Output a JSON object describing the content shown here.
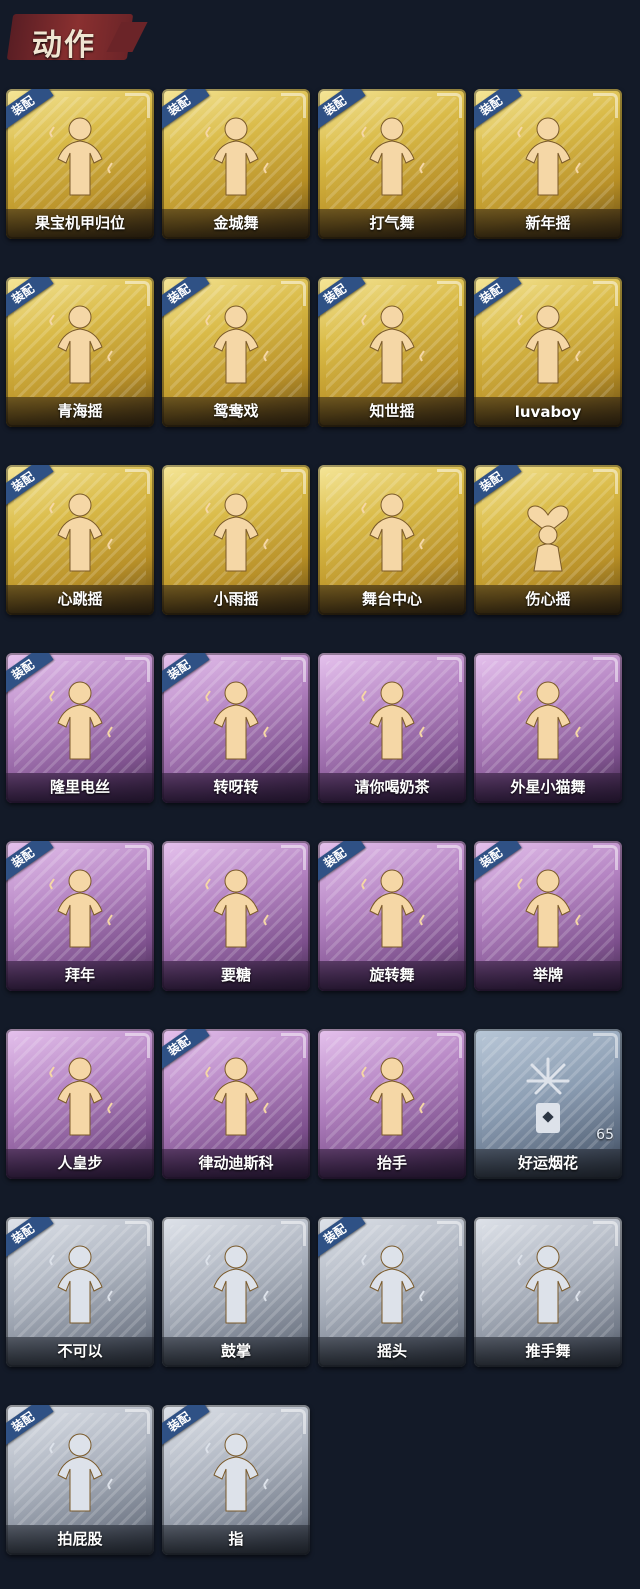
{
  "header": {
    "title": "动作"
  },
  "badge_label": "装配",
  "cards": [
    {
      "label": "果宝机甲归位",
      "tier": "gold",
      "equipped": true,
      "icon": "dance-pose-icon"
    },
    {
      "label": "金城舞",
      "tier": "gold",
      "equipped": true,
      "icon": "dance-pose-icon"
    },
    {
      "label": "打气舞",
      "tier": "gold",
      "equipped": true,
      "icon": "dance-pose-icon"
    },
    {
      "label": "新年摇",
      "tier": "gold",
      "equipped": true,
      "icon": "dance-pose-icon"
    },
    {
      "label": "青海摇",
      "tier": "gold",
      "equipped": true,
      "icon": "dance-pose-icon"
    },
    {
      "label": "鸳鸯戏",
      "tier": "gold",
      "equipped": true,
      "icon": "dance-pose-icon"
    },
    {
      "label": "知世摇",
      "tier": "gold",
      "equipped": true,
      "icon": "dance-pose-icon"
    },
    {
      "label": "luvaboy",
      "tier": "gold",
      "equipped": true,
      "icon": "dance-pose-icon"
    },
    {
      "label": "心跳摇",
      "tier": "gold",
      "equipped": true,
      "icon": "dance-pose-icon"
    },
    {
      "label": "小雨摇",
      "tier": "gold",
      "equipped": false,
      "icon": "dance-pose-icon"
    },
    {
      "label": "舞台中心",
      "tier": "gold",
      "equipped": false,
      "icon": "dance-pose-icon"
    },
    {
      "label": "伤心摇",
      "tier": "gold",
      "equipped": true,
      "icon": "heart-hands-icon"
    },
    {
      "label": "隆里电丝",
      "tier": "purple",
      "equipped": true,
      "icon": "dance-pose-icon"
    },
    {
      "label": "转呀转",
      "tier": "purple",
      "equipped": true,
      "icon": "girl-bunny-icon"
    },
    {
      "label": "请你喝奶茶",
      "tier": "purple",
      "equipped": false,
      "icon": "tray-icon"
    },
    {
      "label": "外星小猫舞",
      "tier": "purple",
      "equipped": false,
      "icon": "dance-pose-icon"
    },
    {
      "label": "拜年",
      "tier": "purple",
      "equipped": true,
      "icon": "bow-pose-icon"
    },
    {
      "label": "要糖",
      "tier": "purple",
      "equipped": false,
      "icon": "reach-pose-icon"
    },
    {
      "label": "旋转舞",
      "tier": "purple",
      "equipped": true,
      "icon": "spin-pose-icon"
    },
    {
      "label": "举牌",
      "tier": "purple",
      "equipped": true,
      "icon": "sign-hold-icon"
    },
    {
      "label": "人皇步",
      "tier": "purple",
      "equipped": false,
      "icon": "dance-pose-icon"
    },
    {
      "label": "律动迪斯科",
      "tier": "purple",
      "equipped": true,
      "icon": "disco-pose-icon"
    },
    {
      "label": "抬手",
      "tier": "purple",
      "equipped": false,
      "icon": "raise-hand-icon"
    },
    {
      "label": "好运烟花",
      "tier": "bluegrey",
      "equipped": false,
      "icon": "firework-icon",
      "count": "65"
    },
    {
      "label": "不可以",
      "tier": "grey",
      "equipped": true,
      "icon": "finger-wag-icon"
    },
    {
      "label": "鼓掌",
      "tier": "grey",
      "equipped": false,
      "icon": "clap-icon"
    },
    {
      "label": "摇头",
      "tier": "grey",
      "equipped": true,
      "icon": "head-shake-icon"
    },
    {
      "label": "推手舞",
      "tier": "grey",
      "equipped": false,
      "icon": "push-hand-icon"
    },
    {
      "label": "拍屁股",
      "tier": "grey",
      "equipped": true,
      "icon": "slap-pose-icon"
    },
    {
      "label": "指",
      "tier": "grey",
      "equipped": true,
      "icon": "point-icon"
    }
  ]
}
